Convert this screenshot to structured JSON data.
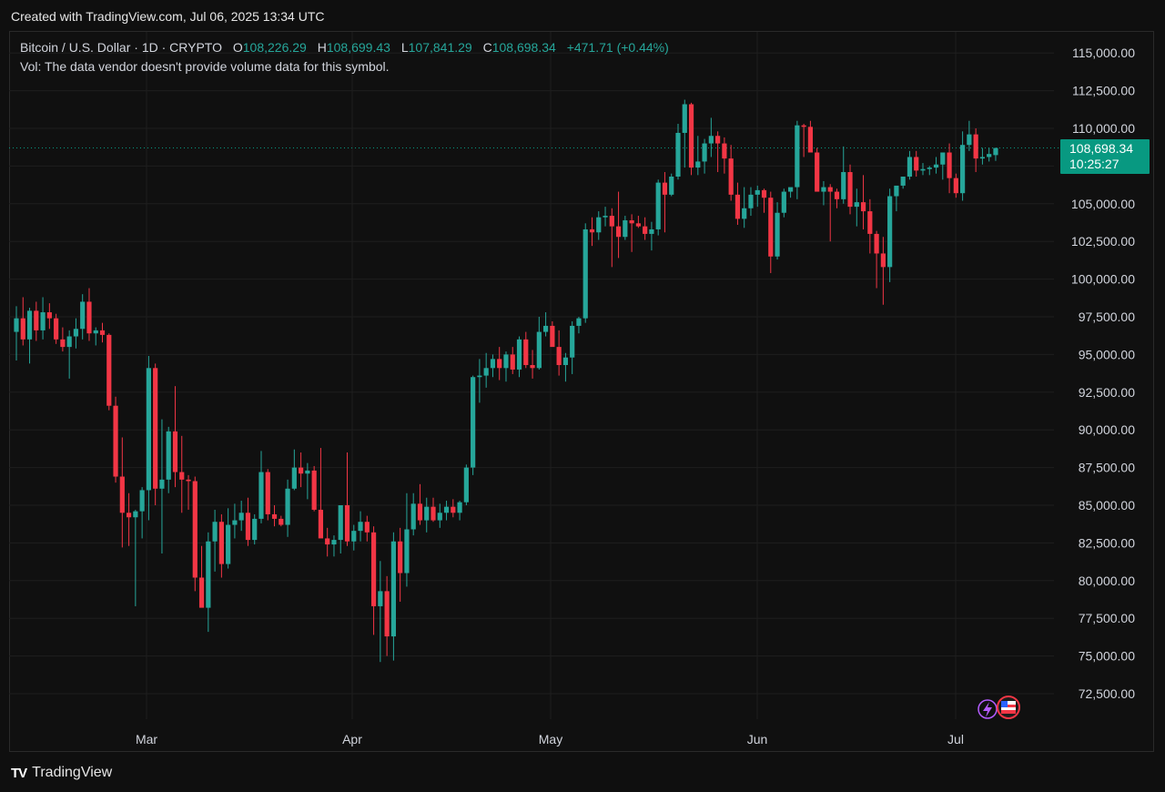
{
  "header": {
    "caption": "Created with TradingView.com, Jul 06, 2025 13:34 UTC"
  },
  "legend": {
    "symbol": "Bitcoin / U.S. Dollar · 1D · CRYPTO",
    "o_key": "O",
    "o_val": "108,226.29",
    "h_key": "H",
    "h_val": "108,699.43",
    "l_key": "L",
    "l_val": "107,841.29",
    "c_key": "C",
    "c_val": "108,698.34",
    "change": "+471.71 (+0.44%)",
    "volume_note": "Vol: The data vendor doesn't provide volume data for this symbol."
  },
  "price_label": {
    "price": "108,698.34",
    "countdown": "10:25:27"
  },
  "brand": {
    "name": "TradingView",
    "logo_text": "TV"
  },
  "icons": [
    "lightning-icon",
    "us-flag-icon"
  ],
  "colors": {
    "up": "#26a69a",
    "down": "#f23645",
    "grid": "#1e1e1e",
    "text": "#d1d4dc",
    "tag": "#089981",
    "lightning": "#b45cff",
    "flag_ring": "#f23645"
  },
  "chart_data": {
    "type": "candlestick",
    "title": "Bitcoin / U.S. Dollar · 1D · CRYPTO",
    "x_tick_labels": [
      "Mar",
      "Apr",
      "May",
      "Jun",
      "Jul"
    ],
    "y_tick_labels": [
      "115,000.00",
      "112,500.00",
      "110,000.00",
      "107,500.00",
      "105,000.00",
      "102,500.00",
      "100,000.00",
      "97,500.00",
      "95,000.00",
      "92,500.00",
      "90,000.00",
      "87,500.00",
      "85,000.00",
      "82,500.00",
      "80,000.00",
      "77,500.00",
      "75,000.00",
      "72,500.00"
    ],
    "ylim": [
      71000,
      116000
    ],
    "last_price": 108698.34,
    "grid": true,
    "candles": [
      {
        "o": 96500,
        "h": 98200,
        "l": 94600,
        "c": 97400
      },
      {
        "o": 97400,
        "h": 98800,
        "l": 95600,
        "c": 96000
      },
      {
        "o": 96000,
        "h": 98100,
        "l": 94400,
        "c": 97900
      },
      {
        "o": 97900,
        "h": 98500,
        "l": 95900,
        "c": 96600
      },
      {
        "o": 96600,
        "h": 98800,
        "l": 96000,
        "c": 97800
      },
      {
        "o": 97800,
        "h": 98400,
        "l": 96700,
        "c": 97400
      },
      {
        "o": 97400,
        "h": 97700,
        "l": 95700,
        "c": 96000
      },
      {
        "o": 96000,
        "h": 96800,
        "l": 95200,
        "c": 95500
      },
      {
        "o": 95500,
        "h": 96600,
        "l": 93400,
        "c": 96200
      },
      {
        "o": 96200,
        "h": 97400,
        "l": 95400,
        "c": 96700
      },
      {
        "o": 96700,
        "h": 99000,
        "l": 96000,
        "c": 98500
      },
      {
        "o": 98500,
        "h": 99400,
        "l": 95900,
        "c": 96400
      },
      {
        "o": 96400,
        "h": 96800,
        "l": 95600,
        "c": 96600
      },
      {
        "o": 96600,
        "h": 97100,
        "l": 95800,
        "c": 96300
      },
      {
        "o": 96300,
        "h": 96400,
        "l": 91300,
        "c": 91600
      },
      {
        "o": 91600,
        "h": 92200,
        "l": 86500,
        "c": 86900
      },
      {
        "o": 86900,
        "h": 89500,
        "l": 82200,
        "c": 84500
      },
      {
        "o": 84500,
        "h": 85800,
        "l": 82300,
        "c": 84200
      },
      {
        "o": 84200,
        "h": 84700,
        "l": 78300,
        "c": 84600
      },
      {
        "o": 84600,
        "h": 86200,
        "l": 82800,
        "c": 86000
      },
      {
        "o": 86000,
        "h": 94900,
        "l": 84000,
        "c": 94100
      },
      {
        "o": 94100,
        "h": 94400,
        "l": 85000,
        "c": 86100
      },
      {
        "o": 86100,
        "h": 90700,
        "l": 81800,
        "c": 86700
      },
      {
        "o": 86700,
        "h": 90200,
        "l": 85800,
        "c": 89900
      },
      {
        "o": 89900,
        "h": 92900,
        "l": 86200,
        "c": 87200
      },
      {
        "o": 87200,
        "h": 89600,
        "l": 84500,
        "c": 86700
      },
      {
        "o": 86700,
        "h": 87000,
        "l": 84700,
        "c": 86600
      },
      {
        "o": 86600,
        "h": 86900,
        "l": 79300,
        "c": 80200
      },
      {
        "o": 80200,
        "h": 82300,
        "l": 78600,
        "c": 78200
      },
      {
        "o": 78200,
        "h": 83200,
        "l": 76600,
        "c": 82600
      },
      {
        "o": 82600,
        "h": 84700,
        "l": 80600,
        "c": 83900
      },
      {
        "o": 83900,
        "h": 84400,
        "l": 80200,
        "c": 81100
      },
      {
        "o": 81100,
        "h": 84800,
        "l": 80800,
        "c": 83700
      },
      {
        "o": 83700,
        "h": 85100,
        "l": 82800,
        "c": 84000
      },
      {
        "o": 84000,
        "h": 85300,
        "l": 83300,
        "c": 84500
      },
      {
        "o": 84500,
        "h": 85500,
        "l": 82300,
        "c": 82700
      },
      {
        "o": 82700,
        "h": 84400,
        "l": 82400,
        "c": 84100
      },
      {
        "o": 84100,
        "h": 88600,
        "l": 83800,
        "c": 87200
      },
      {
        "o": 87200,
        "h": 87400,
        "l": 84000,
        "c": 84400
      },
      {
        "o": 84400,
        "h": 85000,
        "l": 83600,
        "c": 84100
      },
      {
        "o": 84100,
        "h": 84300,
        "l": 83600,
        "c": 83700
      },
      {
        "o": 83700,
        "h": 86700,
        "l": 82900,
        "c": 86100
      },
      {
        "o": 86100,
        "h": 88700,
        "l": 86000,
        "c": 87500
      },
      {
        "o": 87500,
        "h": 88500,
        "l": 86200,
        "c": 87100
      },
      {
        "o": 87100,
        "h": 87800,
        "l": 85400,
        "c": 87300
      },
      {
        "o": 87300,
        "h": 87600,
        "l": 84600,
        "c": 84700
      },
      {
        "o": 84700,
        "h": 88800,
        "l": 83700,
        "c": 82800
      },
      {
        "o": 82800,
        "h": 83500,
        "l": 81600,
        "c": 82400
      },
      {
        "o": 82400,
        "h": 83000,
        "l": 81600,
        "c": 82700
      },
      {
        "o": 82700,
        "h": 84400,
        "l": 81800,
        "c": 85000
      },
      {
        "o": 85000,
        "h": 88500,
        "l": 82300,
        "c": 82600
      },
      {
        "o": 82600,
        "h": 83700,
        "l": 82000,
        "c": 83300
      },
      {
        "o": 83300,
        "h": 84600,
        "l": 82600,
        "c": 83900
      },
      {
        "o": 83900,
        "h": 84300,
        "l": 82600,
        "c": 83200
      },
      {
        "o": 83200,
        "h": 83600,
        "l": 76400,
        "c": 78300
      },
      {
        "o": 78300,
        "h": 81300,
        "l": 74600,
        "c": 79300
      },
      {
        "o": 79300,
        "h": 80300,
        "l": 75000,
        "c": 76300
      },
      {
        "o": 76300,
        "h": 83200,
        "l": 74700,
        "c": 82600
      },
      {
        "o": 82600,
        "h": 83500,
        "l": 78600,
        "c": 80500
      },
      {
        "o": 80500,
        "h": 85800,
        "l": 79600,
        "c": 83400
      },
      {
        "o": 83400,
        "h": 85800,
        "l": 83000,
        "c": 85100
      },
      {
        "o": 85100,
        "h": 86400,
        "l": 83700,
        "c": 84000
      },
      {
        "o": 84000,
        "h": 85500,
        "l": 83200,
        "c": 84900
      },
      {
        "o": 84900,
        "h": 85500,
        "l": 83900,
        "c": 84000
      },
      {
        "o": 84000,
        "h": 85100,
        "l": 83500,
        "c": 84500
      },
      {
        "o": 84500,
        "h": 85300,
        "l": 84000,
        "c": 84900
      },
      {
        "o": 84900,
        "h": 85400,
        "l": 84200,
        "c": 84500
      },
      {
        "o": 84500,
        "h": 85300,
        "l": 84000,
        "c": 85200
      },
      {
        "o": 85200,
        "h": 87700,
        "l": 85000,
        "c": 87500
      },
      {
        "o": 87500,
        "h": 93600,
        "l": 87000,
        "c": 93500
      },
      {
        "o": 93500,
        "h": 94700,
        "l": 91800,
        "c": 93600
      },
      {
        "o": 93600,
        "h": 95100,
        "l": 92800,
        "c": 94100
      },
      {
        "o": 94100,
        "h": 95000,
        "l": 93500,
        "c": 94700
      },
      {
        "o": 94700,
        "h": 95500,
        "l": 93300,
        "c": 94100
      },
      {
        "o": 94100,
        "h": 95200,
        "l": 93200,
        "c": 95000
      },
      {
        "o": 95000,
        "h": 95500,
        "l": 93700,
        "c": 94000
      },
      {
        "o": 94000,
        "h": 96200,
        "l": 93500,
        "c": 96000
      },
      {
        "o": 96000,
        "h": 96500,
        "l": 94100,
        "c": 94300
      },
      {
        "o": 94300,
        "h": 95300,
        "l": 93400,
        "c": 94100
      },
      {
        "o": 94100,
        "h": 97500,
        "l": 94000,
        "c": 96500
      },
      {
        "o": 96500,
        "h": 97800,
        "l": 96200,
        "c": 96900
      },
      {
        "o": 96900,
        "h": 97200,
        "l": 95800,
        "c": 95500
      },
      {
        "o": 95500,
        "h": 96600,
        "l": 93600,
        "c": 94300
      },
      {
        "o": 94300,
        "h": 95100,
        "l": 93200,
        "c": 94800
      },
      {
        "o": 94800,
        "h": 97200,
        "l": 93700,
        "c": 96900
      },
      {
        "o": 96900,
        "h": 97500,
        "l": 96400,
        "c": 97400
      },
      {
        "o": 97400,
        "h": 103700,
        "l": 97100,
        "c": 103300
      },
      {
        "o": 103300,
        "h": 104100,
        "l": 102200,
        "c": 103100
      },
      {
        "o": 103100,
        "h": 104500,
        "l": 102600,
        "c": 104100
      },
      {
        "o": 104100,
        "h": 104800,
        "l": 103500,
        "c": 104200
      },
      {
        "o": 104200,
        "h": 104700,
        "l": 100800,
        "c": 103500
      },
      {
        "o": 103500,
        "h": 105800,
        "l": 101400,
        "c": 102800
      },
      {
        "o": 102800,
        "h": 104200,
        "l": 102600,
        "c": 103900
      },
      {
        "o": 103900,
        "h": 104300,
        "l": 101800,
        "c": 103700
      },
      {
        "o": 103700,
        "h": 104200,
        "l": 103400,
        "c": 103500
      },
      {
        "o": 103500,
        "h": 104100,
        "l": 102600,
        "c": 103000
      },
      {
        "o": 103000,
        "h": 103800,
        "l": 101900,
        "c": 103300
      },
      {
        "o": 103300,
        "h": 106600,
        "l": 102900,
        "c": 106400
      },
      {
        "o": 106400,
        "h": 107100,
        "l": 103100,
        "c": 105600
      },
      {
        "o": 105600,
        "h": 107000,
        "l": 105500,
        "c": 106800
      },
      {
        "o": 106800,
        "h": 110300,
        "l": 106600,
        "c": 109700
      },
      {
        "o": 109700,
        "h": 111900,
        "l": 107400,
        "c": 111600
      },
      {
        "o": 111600,
        "h": 111700,
        "l": 106900,
        "c": 107400
      },
      {
        "o": 107400,
        "h": 109500,
        "l": 106900,
        "c": 107800
      },
      {
        "o": 107800,
        "h": 109300,
        "l": 107000,
        "c": 109000
      },
      {
        "o": 109000,
        "h": 110700,
        "l": 108100,
        "c": 109500
      },
      {
        "o": 109500,
        "h": 109800,
        "l": 107100,
        "c": 109000
      },
      {
        "o": 109000,
        "h": 109400,
        "l": 107000,
        "c": 108000
      },
      {
        "o": 108000,
        "h": 108900,
        "l": 105200,
        "c": 105600
      },
      {
        "o": 105600,
        "h": 106400,
        "l": 103600,
        "c": 104000
      },
      {
        "o": 104000,
        "h": 106100,
        "l": 103400,
        "c": 104700
      },
      {
        "o": 104700,
        "h": 106100,
        "l": 104200,
        "c": 105600
      },
      {
        "o": 105600,
        "h": 106200,
        "l": 104800,
        "c": 105900
      },
      {
        "o": 105900,
        "h": 106000,
        "l": 104400,
        "c": 105400
      },
      {
        "o": 105400,
        "h": 105800,
        "l": 100400,
        "c": 101500
      },
      {
        "o": 101500,
        "h": 105100,
        "l": 101300,
        "c": 104400
      },
      {
        "o": 104400,
        "h": 106000,
        "l": 104100,
        "c": 105800
      },
      {
        "o": 105800,
        "h": 106000,
        "l": 105400,
        "c": 106100
      },
      {
        "o": 106100,
        "h": 110500,
        "l": 105300,
        "c": 110200
      },
      {
        "o": 110200,
        "h": 110300,
        "l": 108100,
        "c": 110100
      },
      {
        "o": 110100,
        "h": 110500,
        "l": 108400,
        "c": 108400
      },
      {
        "o": 108400,
        "h": 108700,
        "l": 105800,
        "c": 105800
      },
      {
        "o": 105800,
        "h": 106500,
        "l": 104900,
        "c": 106100
      },
      {
        "o": 106100,
        "h": 106300,
        "l": 102500,
        "c": 105800
      },
      {
        "o": 105800,
        "h": 106000,
        "l": 104700,
        "c": 105300
      },
      {
        "o": 105300,
        "h": 108800,
        "l": 105000,
        "c": 107100
      },
      {
        "o": 107100,
        "h": 107600,
        "l": 104300,
        "c": 104800
      },
      {
        "o": 104800,
        "h": 106000,
        "l": 103500,
        "c": 105100
      },
      {
        "o": 105100,
        "h": 106900,
        "l": 103300,
        "c": 104500
      },
      {
        "o": 104500,
        "h": 105300,
        "l": 101700,
        "c": 103000
      },
      {
        "o": 103000,
        "h": 103200,
        "l": 99400,
        "c": 101700
      },
      {
        "o": 101700,
        "h": 102800,
        "l": 98300,
        "c": 100800
      },
      {
        "o": 100800,
        "h": 106000,
        "l": 99800,
        "c": 105500
      },
      {
        "o": 105500,
        "h": 106100,
        "l": 104500,
        "c": 106200
      },
      {
        "o": 106200,
        "h": 106700,
        "l": 106000,
        "c": 106800
      },
      {
        "o": 106800,
        "h": 108500,
        "l": 106600,
        "c": 108100
      },
      {
        "o": 108100,
        "h": 108500,
        "l": 106800,
        "c": 107200
      },
      {
        "o": 107200,
        "h": 107700,
        "l": 106900,
        "c": 107300
      },
      {
        "o": 107300,
        "h": 107500,
        "l": 106900,
        "c": 107400
      },
      {
        "o": 107400,
        "h": 108100,
        "l": 107000,
        "c": 107600
      },
      {
        "o": 107600,
        "h": 108300,
        "l": 106600,
        "c": 108400
      },
      {
        "o": 108400,
        "h": 109000,
        "l": 105700,
        "c": 106700
      },
      {
        "o": 106700,
        "h": 107000,
        "l": 105400,
        "c": 105700
      },
      {
        "o": 105700,
        "h": 109800,
        "l": 105200,
        "c": 108900
      },
      {
        "o": 108900,
        "h": 110500,
        "l": 108500,
        "c": 109600
      },
      {
        "o": 109600,
        "h": 110000,
        "l": 107100,
        "c": 108000
      },
      {
        "o": 108000,
        "h": 108700,
        "l": 107600,
        "c": 108100
      },
      {
        "o": 108100,
        "h": 108700,
        "l": 107800,
        "c": 108300
      },
      {
        "o": 108226.29,
        "h": 108699.43,
        "l": 107841.29,
        "c": 108698.34
      }
    ]
  }
}
